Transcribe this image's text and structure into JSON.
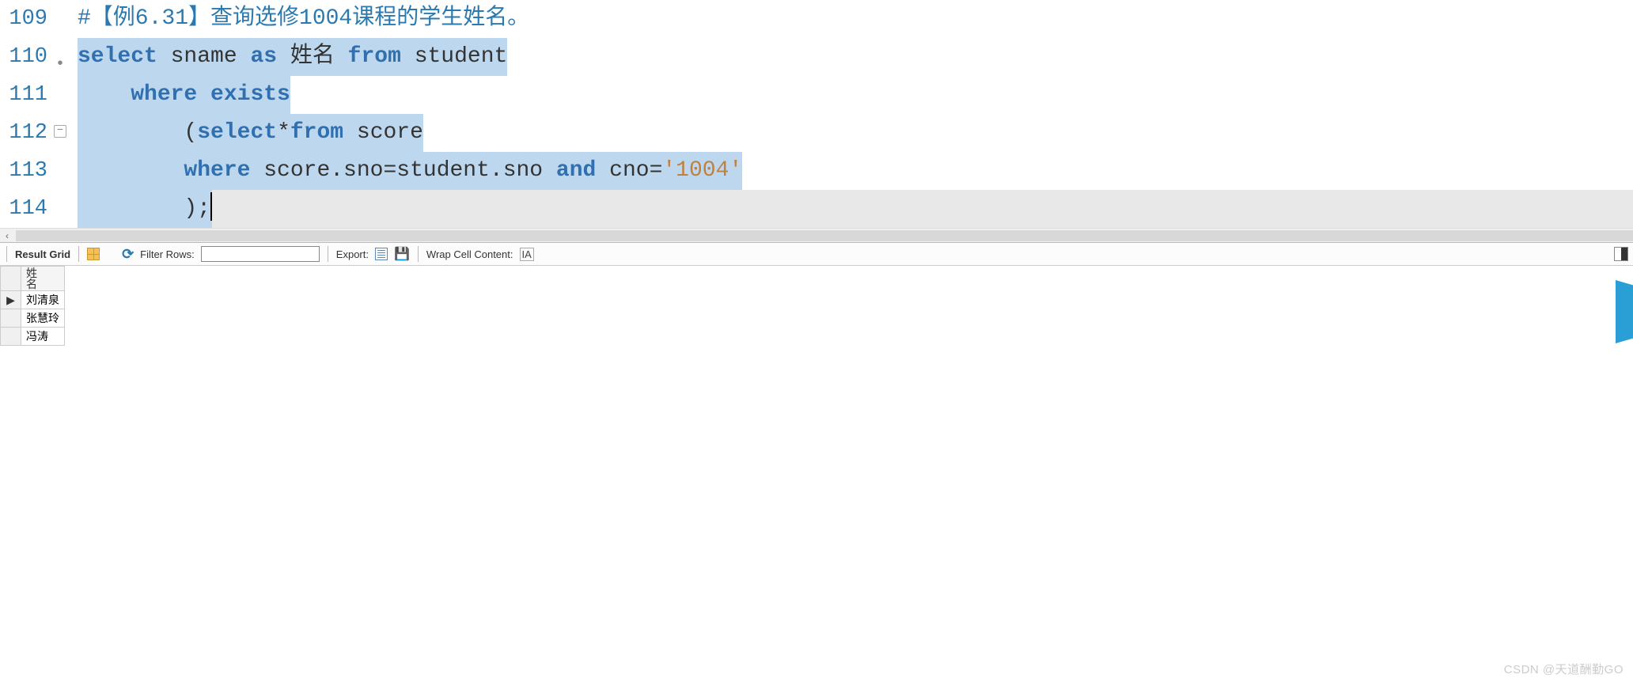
{
  "editor": {
    "lines": [
      {
        "num": "109",
        "bullet": false,
        "fold": null,
        "tokens": [
          {
            "cls": "comment",
            "txt": "#【例6.31】查询选修1004课程的学生姓名。"
          }
        ],
        "hl": false
      },
      {
        "num": "110",
        "bullet": true,
        "fold": null,
        "tokens": [
          {
            "cls": "keyword",
            "txt": "select"
          },
          {
            "cls": "ident",
            "txt": " sname "
          },
          {
            "cls": "keyword",
            "txt": "as"
          },
          {
            "cls": "ident",
            "txt": " 姓名 "
          },
          {
            "cls": "keyword",
            "txt": "from"
          },
          {
            "cls": "ident",
            "txt": " student"
          }
        ],
        "hl": true
      },
      {
        "num": "111",
        "bullet": false,
        "fold": null,
        "tokens": [
          {
            "cls": "ident",
            "txt": "    "
          },
          {
            "cls": "keyword",
            "txt": "where"
          },
          {
            "cls": "ident",
            "txt": " "
          },
          {
            "cls": "keyword",
            "txt": "exists"
          }
        ],
        "hl": true
      },
      {
        "num": "112",
        "bullet": false,
        "fold": "minus",
        "tokens": [
          {
            "cls": "ident",
            "txt": "        "
          },
          {
            "cls": "punct",
            "txt": "("
          },
          {
            "cls": "keyword",
            "txt": "select"
          },
          {
            "cls": "punct",
            "txt": "*"
          },
          {
            "cls": "keyword",
            "txt": "from"
          },
          {
            "cls": "ident",
            "txt": " score"
          }
        ],
        "hl": true
      },
      {
        "num": "113",
        "bullet": false,
        "fold": "line",
        "tokens": [
          {
            "cls": "ident",
            "txt": "        "
          },
          {
            "cls": "keyword",
            "txt": "where"
          },
          {
            "cls": "ident",
            "txt": " score.sno"
          },
          {
            "cls": "punct",
            "txt": "="
          },
          {
            "cls": "ident",
            "txt": "student.sno "
          },
          {
            "cls": "keyword",
            "txt": "and"
          },
          {
            "cls": "ident",
            "txt": " cno"
          },
          {
            "cls": "punct",
            "txt": "="
          },
          {
            "cls": "string",
            "txt": "'1004'"
          }
        ],
        "hl": true
      },
      {
        "num": "114",
        "bullet": false,
        "fold": "end",
        "tokens": [
          {
            "cls": "ident",
            "txt": "        "
          },
          {
            "cls": "punct",
            "txt": ");"
          }
        ],
        "hl": "last"
      }
    ]
  },
  "toolbar": {
    "result_grid": "Result Grid",
    "filter_rows": "Filter Rows:",
    "filter_value": "",
    "export": "Export:",
    "wrap": "Wrap Cell Content:",
    "wrap_icon": "IA"
  },
  "results": {
    "header": "姓\n名",
    "rows": [
      {
        "selected": true,
        "name": "刘清泉"
      },
      {
        "selected": false,
        "name": "张慧玲"
      },
      {
        "selected": false,
        "name": "冯涛"
      }
    ]
  },
  "watermark": "CSDN @天道酬勤GO"
}
